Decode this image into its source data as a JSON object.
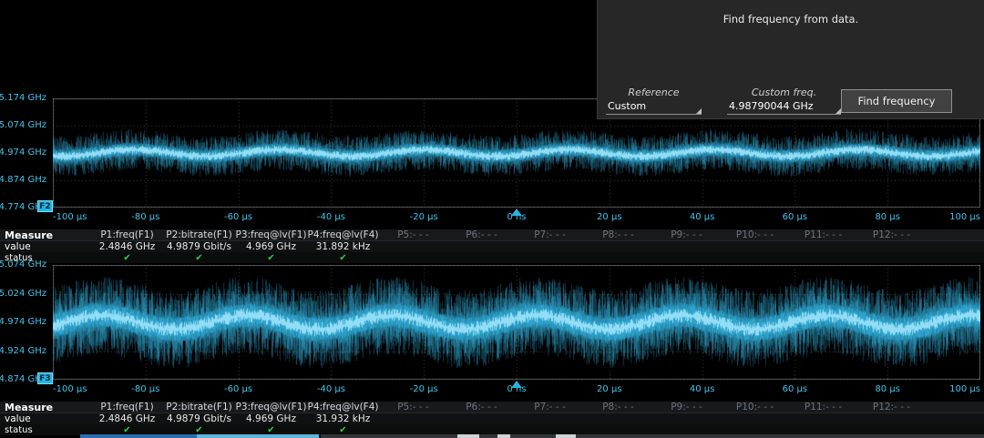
{
  "dialog": {
    "message": "Find frequency from data.",
    "reference_label": "Reference",
    "reference_value": "Custom",
    "custom_freq_label": "Custom freq.",
    "custom_freq_value": "4.98790044 GHz",
    "button_label": "Find frequency"
  },
  "panels": [
    {
      "badge": "F2",
      "y_labels": [
        "5.174 GHz",
        "5.074 GHz",
        "4.974 GHz",
        "4.874 GHz",
        "4.774 GHz"
      ],
      "x_labels": [
        "-100 µs",
        "-80 µs",
        "-60 µs",
        "-40 µs",
        "-20 µs",
        "0 ns",
        "20 µs",
        "40 µs",
        "60 µs",
        "80 µs",
        "100 µs"
      ]
    },
    {
      "badge": "F3",
      "y_labels": [
        "5.074 GHz",
        "5.024 GHz",
        "4.974 GHz",
        "4.924 GHz",
        "4.874 GHz"
      ],
      "x_labels": [
        "-100 µs",
        "-80 µs",
        "-60 µs",
        "-40 µs",
        "-20 µs",
        "0 ns",
        "20 µs",
        "40 µs",
        "60 µs",
        "80 µs",
        "100 µs"
      ]
    }
  ],
  "tables": [
    {
      "title": "Measure",
      "row_label_value": "value",
      "row_label_status": "status",
      "headers": [
        "P1:freq(F1)",
        "P2:bitrate(F1)",
        "P3:freq@lv(F1)",
        "P4:freq@lv(F4)",
        "P5:- - -",
        "P6:- - -",
        "P7:- - -",
        "P8:- - -",
        "P9:- - -",
        "P10:- - -",
        "P11:- - -",
        "P12:- - -"
      ],
      "values": [
        "2.4846 GHz",
        "4.9879 Gbit/s",
        "4.969 GHz",
        "31.892 kHz"
      ],
      "status_marks": [
        "✔",
        "✔",
        "✔",
        "✔"
      ]
    },
    {
      "title": "Measure",
      "row_label_value": "value",
      "row_label_status": "status",
      "headers": [
        "P1:freq(F1)",
        "P2:bitrate(F1)",
        "P3:freq@lv(F1)",
        "P4:freq@lv(F4)",
        "P5:- - -",
        "P6:- - -",
        "P7:- - -",
        "P8:- - -",
        "P9:- - -",
        "P10:- - -",
        "P11:- - -",
        "P12:- - -"
      ],
      "values": [
        "2.4846 GHz",
        "4.9879 Gbit/s",
        "4.969 GHz",
        "31.932 kHz"
      ],
      "status_marks": [
        "✔",
        "✔",
        "✔",
        "✔"
      ]
    }
  ],
  "chart_data": [
    {
      "type": "waveform",
      "name": "F2 frequency-vs-time track",
      "canvas": "wave1",
      "x_range": {
        "min_us": -100,
        "max_us": 100,
        "tick_step_us": 20
      },
      "y_range": {
        "top_ghz": 5.174,
        "bottom_ghz": 4.774,
        "tick_step_ghz": 0.1
      },
      "center_ghz": 4.974,
      "modulation_ghz": 0.012,
      "modulation_freq_khz": 31.9,
      "cycles_visible": 6.4,
      "phase": 1.2,
      "core_halfwidth_ghz": 0.02,
      "spike_halfwidth_ghz": 0.055,
      "density": 3,
      "grid": {
        "x_divs": 10,
        "y_divs": 4
      },
      "trace_color": "#35b6e4",
      "core_color": "#9fe4fb"
    },
    {
      "type": "waveform",
      "name": "F3 frequency-vs-time track",
      "canvas": "wave2",
      "x_range": {
        "min_us": -100,
        "max_us": 100,
        "tick_step_us": 20
      },
      "y_range": {
        "top_ghz": 5.074,
        "bottom_ghz": 4.874,
        "tick_step_ghz": 0.05
      },
      "center_ghz": 4.974,
      "modulation_ghz": 0.012,
      "modulation_freq_khz": 31.9,
      "cycles_visible": 6.4,
      "phase": 2.6,
      "core_halfwidth_ghz": 0.018,
      "spike_halfwidth_ghz": 0.05,
      "density": 4,
      "grid": {
        "x_divs": 10,
        "y_divs": 4
      },
      "trace_color": "#35b6e4",
      "core_color": "#9fe4fb"
    }
  ],
  "colors": {
    "axis_label": "#3fc6ea",
    "trace": "#35b6e4",
    "checkmark": "#2ed04e",
    "badge_bg": "#27b3e0",
    "dialog_bg": "#272727"
  }
}
